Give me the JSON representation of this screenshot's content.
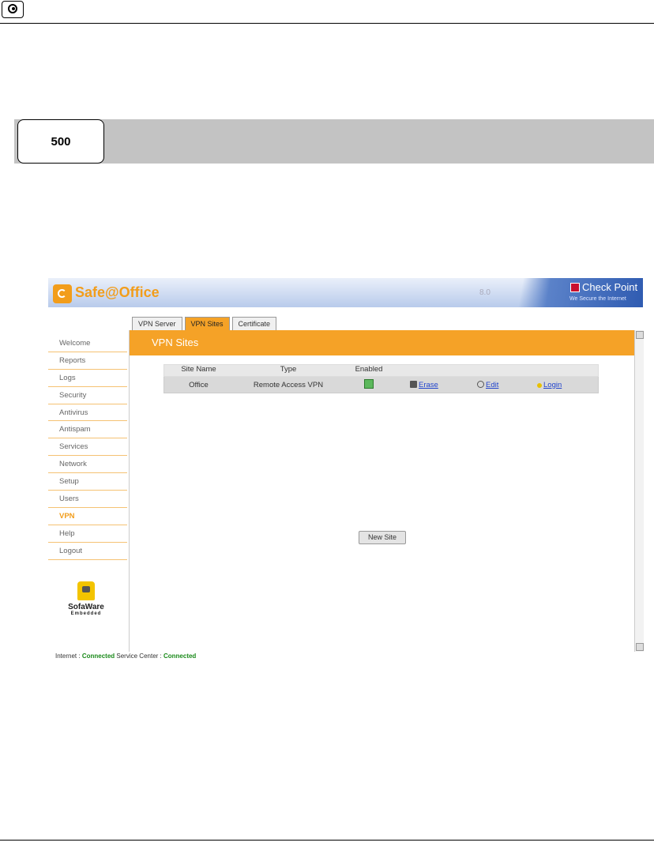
{
  "page": {
    "model_tab": "500"
  },
  "app": {
    "brand": "Safe@Office",
    "version_text": "8.0",
    "vendor": "Check Point",
    "vendor_tagline": "We Secure the Internet"
  },
  "tabs": [
    {
      "label": "VPN Server",
      "active": false
    },
    {
      "label": "VPN Sites",
      "active": true
    },
    {
      "label": "Certificate",
      "active": false
    }
  ],
  "sidebar": {
    "items": [
      {
        "label": "Welcome",
        "active": false
      },
      {
        "label": "Reports",
        "active": false
      },
      {
        "label": "Logs",
        "active": false
      },
      {
        "label": "Security",
        "active": false
      },
      {
        "label": "Antivirus",
        "active": false
      },
      {
        "label": "Antispam",
        "active": false
      },
      {
        "label": "Services",
        "active": false
      },
      {
        "label": "Network",
        "active": false
      },
      {
        "label": "Setup",
        "active": false
      },
      {
        "label": "Users",
        "active": false
      },
      {
        "label": "VPN",
        "active": true
      },
      {
        "label": "Help",
        "active": false
      },
      {
        "label": "Logout",
        "active": false
      }
    ],
    "sofaware_name": "SofaWare",
    "sofaware_sub": "Embedded"
  },
  "main": {
    "title": "VPN Sites",
    "table": {
      "headers": [
        "Site Name",
        "Type",
        "Enabled"
      ],
      "rows": [
        {
          "site_name": "Office",
          "type": "Remote Access VPN",
          "enabled": true,
          "erase": "Erase",
          "edit": "Edit",
          "login": "Login"
        }
      ]
    },
    "new_site_button": "New Site"
  },
  "status": {
    "internet_label": "Internet :",
    "internet_value": "Connected",
    "service_label": "Service Center :",
    "service_value": "Connected"
  },
  "colors": {
    "accent_orange": "#f5a227",
    "link_blue": "#2244cc",
    "connected_green": "#1a8a1a"
  }
}
